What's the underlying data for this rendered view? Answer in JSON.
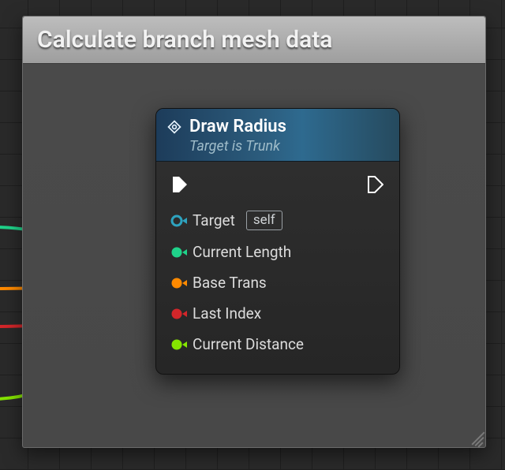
{
  "panel": {
    "title": "Calculate branch mesh data"
  },
  "node": {
    "title": "Draw Radius",
    "subtitle": "Target is Trunk",
    "pins": {
      "target": {
        "label": "Target",
        "default": "self"
      },
      "current_length": {
        "label": "Current Length"
      },
      "base_trans": {
        "label": "Base Trans"
      },
      "last_index": {
        "label": "Last Index"
      },
      "current_distance": {
        "label": "Current Distance"
      }
    }
  },
  "colors": {
    "target_pin": "#2ea3bf",
    "float_pin": "#1fd38a",
    "transform_pin": "#ff8a00",
    "int_pin": "#d3262a",
    "distance_pin": "#85e500",
    "exec": "#ffffff"
  }
}
